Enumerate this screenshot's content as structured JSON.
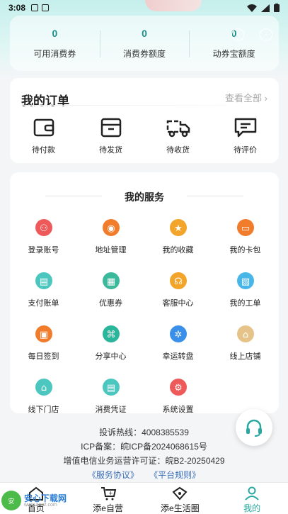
{
  "status_bar": {
    "time": "3:08"
  },
  "stats": [
    {
      "value": "0",
      "label": "可用消费券"
    },
    {
      "value": "0",
      "label": "消费券额度"
    },
    {
      "value": "0",
      "label": "动券宝额度"
    }
  ],
  "orders": {
    "title": "我的订单",
    "view_all": "查看全部",
    "items": [
      {
        "label": "待付款",
        "icon": "wallet-icon"
      },
      {
        "label": "待发货",
        "icon": "box-icon"
      },
      {
        "label": "待收货",
        "icon": "truck-icon"
      },
      {
        "label": "待评价",
        "icon": "comment-icon"
      }
    ]
  },
  "services": {
    "title": "我的服务",
    "items": [
      {
        "label": "登录账号",
        "icon": "account-icon",
        "color": "#ee5a5a"
      },
      {
        "label": "地址管理",
        "icon": "location-icon",
        "color": "#f07c2c"
      },
      {
        "label": "我的收藏",
        "icon": "star-icon",
        "color": "#f3a42a"
      },
      {
        "label": "我的卡包",
        "icon": "card-icon",
        "color": "#f07c2c"
      },
      {
        "label": "支付账单",
        "icon": "bill-icon",
        "color": "#4cc7c0"
      },
      {
        "label": "优惠券",
        "icon": "coupon-icon",
        "color": "#3cb89a"
      },
      {
        "label": "客服中心",
        "icon": "headset-icon",
        "color": "#f3a42a"
      },
      {
        "label": "我的工单",
        "icon": "ticket-icon",
        "color": "#48b7e8"
      },
      {
        "label": "每日签到",
        "icon": "calendar-icon",
        "color": "#f07c2c"
      },
      {
        "label": "分享中心",
        "icon": "share-icon",
        "color": "#2bb59b"
      },
      {
        "label": "幸运转盘",
        "icon": "wheel-icon",
        "color": "#3a8fe8"
      },
      {
        "label": "线上店铺",
        "icon": "shop-icon",
        "color": "#e6c489"
      },
      {
        "label": "线下门店",
        "icon": "store-icon",
        "color": "#4cc7c0"
      },
      {
        "label": "消费凭证",
        "icon": "receipt-icon",
        "color": "#4cc7c0"
      },
      {
        "label": "系统设置",
        "icon": "settings-icon",
        "color": "#ee5a5a"
      }
    ]
  },
  "footer": {
    "hotline": "投诉热线：4008385539",
    "icp": "ICP备案：皖ICP备2024068615号",
    "license": "增值电信业务运营许可证：皖B2-20250429",
    "links": [
      "《服务协议》",
      "《平台规则》"
    ]
  },
  "tabbar": [
    {
      "label": "首页",
      "icon": "home-icon",
      "active": false
    },
    {
      "label": "添e自营",
      "icon": "cart-icon",
      "active": false
    },
    {
      "label": "添e生活圈",
      "icon": "bag-icon",
      "active": false
    },
    {
      "label": "我的",
      "icon": "user-icon",
      "active": true
    }
  ],
  "watermark": {
    "name": "安心下载网",
    "url": "www.anxz.com"
  },
  "colors": {
    "accent": "#27a9a2",
    "stat_value": "#1c8f8a",
    "link": "#3b6fb6"
  }
}
